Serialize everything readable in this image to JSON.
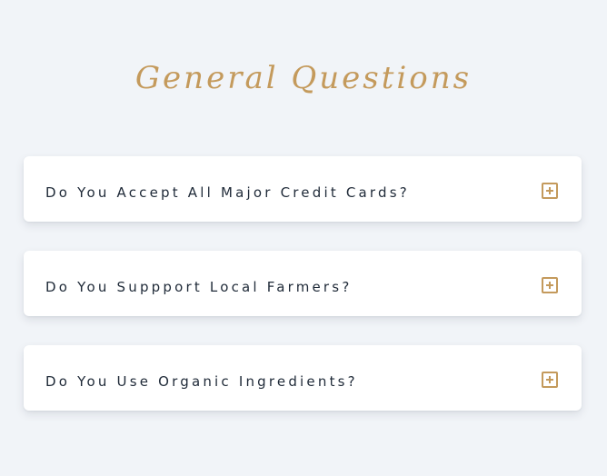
{
  "section": {
    "title": "General Questions"
  },
  "faq": {
    "items": [
      {
        "question": "Do You Accept All Major Credit Cards?",
        "icon": "plus-square-icon"
      },
      {
        "question": "Do You Suppport Local Farmers?",
        "icon": "plus-square-icon"
      },
      {
        "question": "Do You Use Organic Ingredients?",
        "icon": "plus-square-icon"
      }
    ]
  },
  "colors": {
    "background": "#f1f4f8",
    "accent": "#c49a5c",
    "text": "#1f2a38",
    "card": "#ffffff"
  }
}
